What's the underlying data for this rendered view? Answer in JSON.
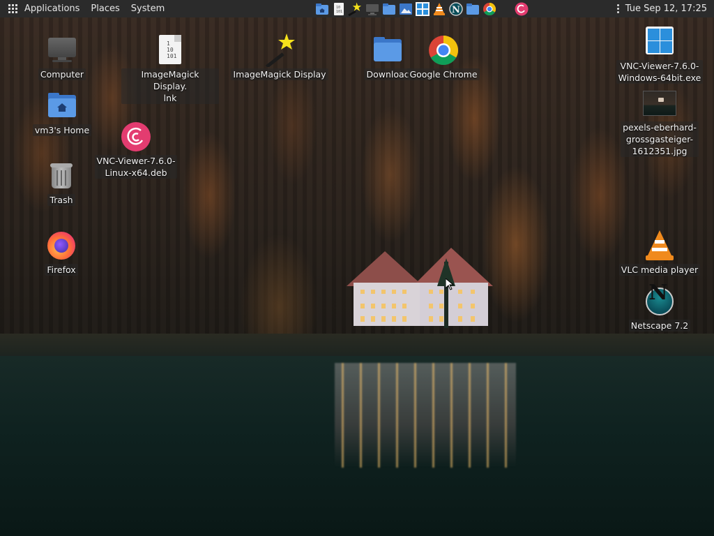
{
  "panel": {
    "menus": [
      "Applications",
      "Places",
      "System"
    ],
    "launchers": [
      {
        "name": "home-folder-launcher"
      },
      {
        "name": "imagemagick-display-lnk-launcher"
      },
      {
        "name": "imagemagick-display-launcher"
      },
      {
        "name": "computer-launcher"
      },
      {
        "name": "folder-launcher"
      },
      {
        "name": "image-viewer-launcher"
      },
      {
        "name": "windows-exe-launcher"
      },
      {
        "name": "vlc-launcher"
      },
      {
        "name": "netscape-launcher"
      },
      {
        "name": "folder-launcher-2"
      },
      {
        "name": "chrome-launcher"
      },
      {
        "name": "debian-package-launcher"
      }
    ],
    "clock": "Tue Sep 12, 17:25"
  },
  "desktop": {
    "computer": "Computer",
    "imagemagick_lnk": "ImageMagick Display.\nlnk",
    "imagemagick": "ImageMagick Display",
    "download_folder": "Downloac",
    "chrome": "Google Chrome",
    "vnc_exe": "VNC-Viewer-7.6.0-\nWindows-64bit.exe",
    "home": "vm3's Home",
    "vnc_deb": "VNC-Viewer-7.6.0-\nLinux-x64.deb",
    "photo": "pexels-eberhard-\ngrossgasteiger-\n1612351.jpg",
    "trash": "Trash",
    "firefox": "Firefox",
    "vlc": "VLC media player",
    "netscape": "Netscape 7.2"
  },
  "colors": {
    "panel_bg": "#2b2b2b",
    "folder_blue": "#5b9ae6",
    "debian_pink": "#e33c70",
    "vlc_orange": "#f08a1d"
  }
}
